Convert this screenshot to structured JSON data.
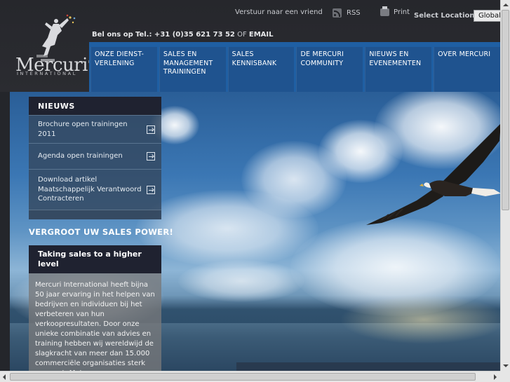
{
  "header": {
    "logo": {
      "word": "Mercuri",
      "registered": "®",
      "sub": "INTERNATIONAL"
    },
    "toplinks": {
      "send_friend": "Verstuur naar een vriend",
      "rss": "RSS",
      "print": "Print"
    },
    "location": {
      "label": "Select Location:",
      "selected": "Global"
    },
    "phone": {
      "prefix": "Bel ons op",
      "number_label": "Tel.: +31 (0)35 621 73 52",
      "or": "OF",
      "email": "EMAIL"
    }
  },
  "nav": {
    "items": [
      {
        "label": "ONZE DIENST-VERLENING",
        "lines": [
          "ONZE DIENST-",
          "VERLENING"
        ]
      },
      {
        "label": "SALES EN MANAGEMENT TRAININGEN",
        "lines": [
          "SALES EN",
          "MANAGEMENT",
          "TRAININGEN"
        ]
      },
      {
        "label": "SALES KENNISBANK",
        "lines": [
          "SALES",
          "KENNISBANK"
        ]
      },
      {
        "label": "DE MERCURI COMMUNITY",
        "lines": [
          "DE MERCURI",
          "COMMUNITY"
        ]
      },
      {
        "label": "NIEUWS EN EVENEMENTEN",
        "lines": [
          "NIEUWS EN",
          "EVENEMENTEN"
        ]
      },
      {
        "label": "OVER MERCURI",
        "lines": [
          "OVER MERCURI"
        ]
      }
    ]
  },
  "news": {
    "title": "NIEUWS",
    "items": [
      {
        "label": "Brochure open trainingen 2011"
      },
      {
        "label": "Agenda open trainingen"
      },
      {
        "label": "Download artikel Maatschappelijk Verantwoord Contracteren"
      }
    ]
  },
  "tagline": "VERGROOT UW SALES POWER!",
  "promo": {
    "title": "Taking sales to a higher level",
    "body": "Mercuri International heeft bijna 50 jaar ervaring in het helpen van bedrijven en individuen bij het verbeteren van hun verkoopresultaten. Door onze unieke combinatie van advies en training hebben wij wereldwijd de slagkracht van meer dan 15.000 commerciële organisaties sterk vergroot. Met"
  },
  "icons": {
    "logo": "mercury-figure-icon",
    "rss": "rss-icon",
    "print": "printer-icon",
    "arrow": "arrow-right-box-icon"
  },
  "colors": {
    "nav_blue": "#1f5fa3",
    "dark_panel": "#1f2230",
    "header_bg": "#26272c"
  }
}
